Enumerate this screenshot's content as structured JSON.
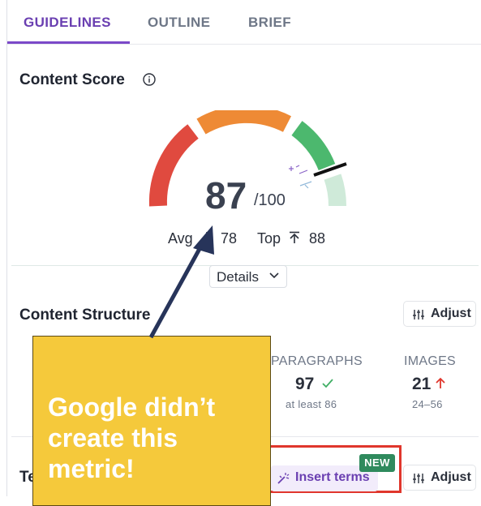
{
  "tabs": [
    {
      "label": "GUIDELINES",
      "active": true
    },
    {
      "label": "OUTLINE",
      "active": false
    },
    {
      "label": "BRIEF",
      "active": false
    }
  ],
  "content_score": {
    "title": "Content Score",
    "score": "87",
    "max": "/100",
    "score_value": 87,
    "avg_label": "Avg",
    "avg_value": "78",
    "top_label": "Top",
    "top_value": "88",
    "details_label": "Details"
  },
  "content_structure": {
    "title": "Content Structure",
    "adjust_label": "Adjust",
    "metrics": [
      {
        "label": "PARAGRAPHS",
        "value": "97",
        "sub": "at least 86",
        "status": "check"
      },
      {
        "label": "IMAGES",
        "value": "21",
        "sub": "24–56",
        "status": "up-arrow"
      }
    ]
  },
  "terms": {
    "title_fragment": "Te",
    "insert_label": "Insert terms",
    "new_badge": "NEW",
    "adjust_label": "Adjust"
  },
  "callout": {
    "text": "Google didn’t create this metric!"
  },
  "colors": {
    "accent": "#6a3fb1",
    "gauge_red": "#e04a3f",
    "gauge_orange": "#ee8a35",
    "gauge_green": "#4cb86e",
    "gauge_light_green": "#cfead9",
    "callout_bg": "#f5c93b",
    "arrow": "#27345a",
    "highlight_box": "#e0362c",
    "badge_green": "#2f8a5d"
  }
}
